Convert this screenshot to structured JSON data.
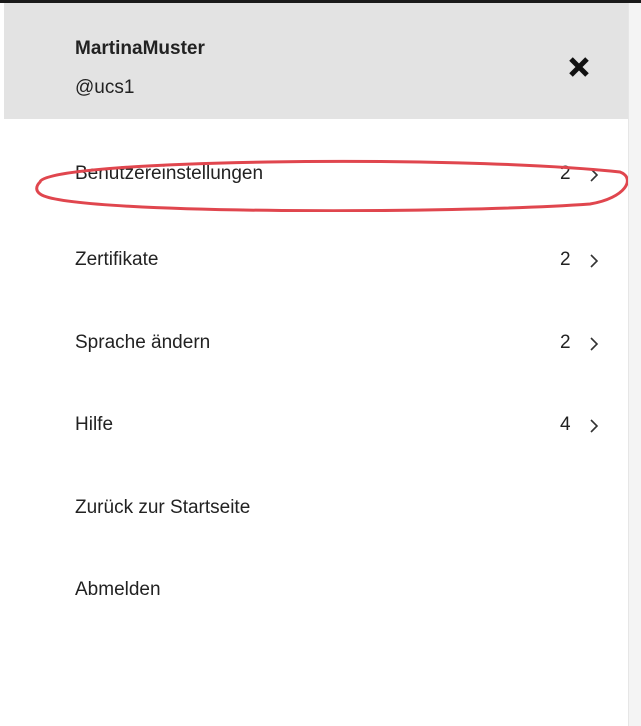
{
  "user": {
    "display_name": "MartinaMuster",
    "handle": "@ucs1"
  },
  "header": {
    "close_icon": "close-icon",
    "background": "#e3e3e3"
  },
  "menu": {
    "items": [
      {
        "label": "Benutzereinstellungen",
        "count": "2",
        "has_submenu": true,
        "highlighted": true
      },
      {
        "label": "Zertifikate",
        "count": "2",
        "has_submenu": true
      },
      {
        "label": "Sprache ändern",
        "count": "2",
        "has_submenu": true
      },
      {
        "label": "Hilfe",
        "count": "4",
        "has_submenu": true
      },
      {
        "label": "Zurück zur Startseite",
        "count": null,
        "has_submenu": false
      },
      {
        "label": "Abmelden",
        "count": null,
        "has_submenu": false
      }
    ]
  },
  "colors": {
    "highlight_ring": "#e0464e",
    "text": "#222222"
  }
}
